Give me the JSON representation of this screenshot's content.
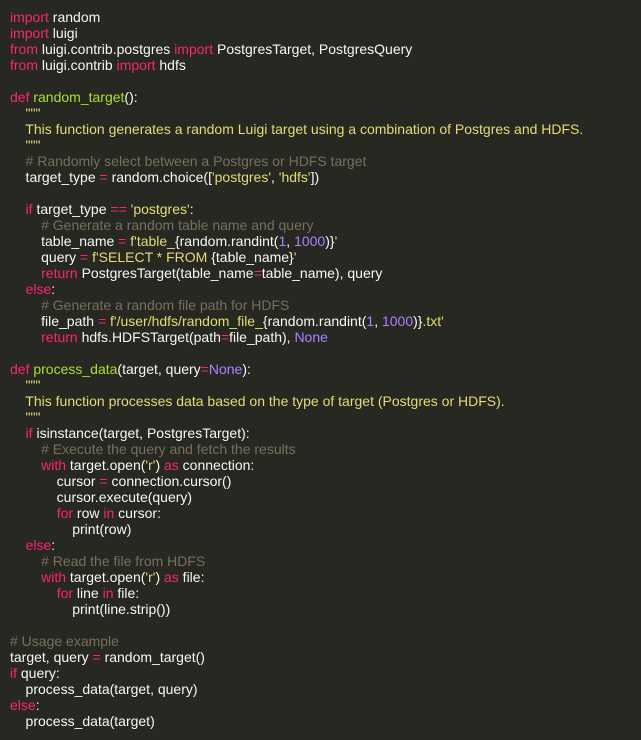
{
  "editor": {
    "colors": {
      "background": "#272822",
      "keyword": "#f92672",
      "function": "#a6e22e",
      "string": "#e6db74",
      "number": "#ae81ff",
      "comment": "#75715e",
      "text": "#f8f8f2"
    },
    "lines": [
      [
        {
          "t": "kw",
          "v": "import"
        },
        {
          "t": "pl",
          "v": " random"
        }
      ],
      [
        {
          "t": "kw",
          "v": "import"
        },
        {
          "t": "pl",
          "v": " luigi"
        }
      ],
      [
        {
          "t": "kw",
          "v": "from"
        },
        {
          "t": "pl",
          "v": " luigi.contrib.postgres "
        },
        {
          "t": "kw",
          "v": "import"
        },
        {
          "t": "pl",
          "v": " PostgresTarget, PostgresQuery"
        }
      ],
      [
        {
          "t": "kw",
          "v": "from"
        },
        {
          "t": "pl",
          "v": " luigi.contrib "
        },
        {
          "t": "kw",
          "v": "import"
        },
        {
          "t": "pl",
          "v": " hdfs"
        }
      ],
      [],
      [
        {
          "t": "kw",
          "v": "def"
        },
        {
          "t": "pl",
          "v": " "
        },
        {
          "t": "fn",
          "v": "random_target"
        },
        {
          "t": "pl",
          "v": "():"
        }
      ],
      [
        {
          "t": "str",
          "v": "    \"\"\""
        }
      ],
      [
        {
          "t": "str",
          "v": "    This function generates a random Luigi target using a combination of Postgres and HDFS."
        }
      ],
      [
        {
          "t": "str",
          "v": "    \"\"\""
        }
      ],
      [
        {
          "t": "cm",
          "v": "    # Randomly select between a Postgres or HDFS target"
        }
      ],
      [
        {
          "t": "pl",
          "v": "    target_type "
        },
        {
          "t": "kw",
          "v": "="
        },
        {
          "t": "pl",
          "v": " random.choice(["
        },
        {
          "t": "str",
          "v": "'postgres'"
        },
        {
          "t": "pl",
          "v": ", "
        },
        {
          "t": "str",
          "v": "'hdfs'"
        },
        {
          "t": "pl",
          "v": "])"
        }
      ],
      [],
      [
        {
          "t": "pl",
          "v": "    "
        },
        {
          "t": "kw",
          "v": "if"
        },
        {
          "t": "pl",
          "v": " target_type "
        },
        {
          "t": "kw",
          "v": "=="
        },
        {
          "t": "pl",
          "v": " "
        },
        {
          "t": "str",
          "v": "'postgres'"
        },
        {
          "t": "pl",
          "v": ":"
        }
      ],
      [
        {
          "t": "cm",
          "v": "        # Generate a random table name and query"
        }
      ],
      [
        {
          "t": "pl",
          "v": "        table_name "
        },
        {
          "t": "kw",
          "v": "="
        },
        {
          "t": "pl",
          "v": " "
        },
        {
          "t": "str",
          "v": "f'table_"
        },
        {
          "t": "pl",
          "v": "{random.randint("
        },
        {
          "t": "num",
          "v": "1"
        },
        {
          "t": "pl",
          "v": ", "
        },
        {
          "t": "num",
          "v": "1000"
        },
        {
          "t": "pl",
          "v": ")}"
        },
        {
          "t": "str",
          "v": "'"
        }
      ],
      [
        {
          "t": "pl",
          "v": "        query "
        },
        {
          "t": "kw",
          "v": "="
        },
        {
          "t": "pl",
          "v": " "
        },
        {
          "t": "str",
          "v": "f'SELECT * FROM "
        },
        {
          "t": "pl",
          "v": "{table_name}"
        },
        {
          "t": "str",
          "v": "'"
        }
      ],
      [
        {
          "t": "pl",
          "v": "        "
        },
        {
          "t": "kw",
          "v": "return"
        },
        {
          "t": "pl",
          "v": " PostgresTarget(table_name"
        },
        {
          "t": "kw",
          "v": "="
        },
        {
          "t": "pl",
          "v": "table_name), query"
        }
      ],
      [
        {
          "t": "pl",
          "v": "    "
        },
        {
          "t": "kw",
          "v": "else"
        },
        {
          "t": "pl",
          "v": ":"
        }
      ],
      [
        {
          "t": "cm",
          "v": "        # Generate a random file path for HDFS"
        }
      ],
      [
        {
          "t": "pl",
          "v": "        file_path "
        },
        {
          "t": "kw",
          "v": "="
        },
        {
          "t": "pl",
          "v": " "
        },
        {
          "t": "str",
          "v": "f'/user/hdfs/random_file_"
        },
        {
          "t": "pl",
          "v": "{random.randint("
        },
        {
          "t": "num",
          "v": "1"
        },
        {
          "t": "pl",
          "v": ", "
        },
        {
          "t": "num",
          "v": "1000"
        },
        {
          "t": "pl",
          "v": ")}"
        },
        {
          "t": "str",
          "v": ".txt'"
        }
      ],
      [
        {
          "t": "pl",
          "v": "        "
        },
        {
          "t": "kw",
          "v": "return"
        },
        {
          "t": "pl",
          "v": " hdfs.HDFSTarget(path"
        },
        {
          "t": "kw",
          "v": "="
        },
        {
          "t": "pl",
          "v": "file_path), "
        },
        {
          "t": "num",
          "v": "None"
        }
      ],
      [],
      [
        {
          "t": "kw",
          "v": "def"
        },
        {
          "t": "pl",
          "v": " "
        },
        {
          "t": "fn",
          "v": "process_data"
        },
        {
          "t": "pl",
          "v": "(target, query"
        },
        {
          "t": "kw",
          "v": "="
        },
        {
          "t": "num",
          "v": "None"
        },
        {
          "t": "pl",
          "v": "):"
        }
      ],
      [
        {
          "t": "str",
          "v": "    \"\"\""
        }
      ],
      [
        {
          "t": "str",
          "v": "    This function processes data based on the type of target (Postgres or HDFS)."
        }
      ],
      [
        {
          "t": "str",
          "v": "    \"\"\""
        }
      ],
      [
        {
          "t": "pl",
          "v": "    "
        },
        {
          "t": "kw",
          "v": "if"
        },
        {
          "t": "pl",
          "v": " isinstance(target, PostgresTarget):"
        }
      ],
      [
        {
          "t": "cm",
          "v": "        # Execute the query and fetch the results"
        }
      ],
      [
        {
          "t": "pl",
          "v": "        "
        },
        {
          "t": "kw",
          "v": "with"
        },
        {
          "t": "pl",
          "v": " target.open("
        },
        {
          "t": "str",
          "v": "'r'"
        },
        {
          "t": "pl",
          "v": ") "
        },
        {
          "t": "kw",
          "v": "as"
        },
        {
          "t": "pl",
          "v": " connection:"
        }
      ],
      [
        {
          "t": "pl",
          "v": "            cursor "
        },
        {
          "t": "kw",
          "v": "="
        },
        {
          "t": "pl",
          "v": " connection.cursor()"
        }
      ],
      [
        {
          "t": "pl",
          "v": "            cursor.execute(query)"
        }
      ],
      [
        {
          "t": "pl",
          "v": "            "
        },
        {
          "t": "kw",
          "v": "for"
        },
        {
          "t": "pl",
          "v": " row "
        },
        {
          "t": "kw",
          "v": "in"
        },
        {
          "t": "pl",
          "v": " cursor:"
        }
      ],
      [
        {
          "t": "pl",
          "v": "                print(row)"
        }
      ],
      [
        {
          "t": "pl",
          "v": "    "
        },
        {
          "t": "kw",
          "v": "else"
        },
        {
          "t": "pl",
          "v": ":"
        }
      ],
      [
        {
          "t": "cm",
          "v": "        # Read the file from HDFS"
        }
      ],
      [
        {
          "t": "pl",
          "v": "        "
        },
        {
          "t": "kw",
          "v": "with"
        },
        {
          "t": "pl",
          "v": " target.open("
        },
        {
          "t": "str",
          "v": "'r'"
        },
        {
          "t": "pl",
          "v": ") "
        },
        {
          "t": "kw",
          "v": "as"
        },
        {
          "t": "pl",
          "v": " file:"
        }
      ],
      [
        {
          "t": "pl",
          "v": "            "
        },
        {
          "t": "kw",
          "v": "for"
        },
        {
          "t": "pl",
          "v": " line "
        },
        {
          "t": "kw",
          "v": "in"
        },
        {
          "t": "pl",
          "v": " file:"
        }
      ],
      [
        {
          "t": "pl",
          "v": "                print(line.strip())"
        }
      ],
      [],
      [
        {
          "t": "cm",
          "v": "# Usage example"
        }
      ],
      [
        {
          "t": "pl",
          "v": "target, query "
        },
        {
          "t": "kw",
          "v": "="
        },
        {
          "t": "pl",
          "v": " random_target()"
        }
      ],
      [
        {
          "t": "kw",
          "v": "if"
        },
        {
          "t": "pl",
          "v": " query:"
        }
      ],
      [
        {
          "t": "pl",
          "v": "    process_data(target, query)"
        }
      ],
      [
        {
          "t": "kw",
          "v": "else"
        },
        {
          "t": "pl",
          "v": ":"
        }
      ],
      [
        {
          "t": "pl",
          "v": "    process_data(target)"
        }
      ]
    ]
  }
}
